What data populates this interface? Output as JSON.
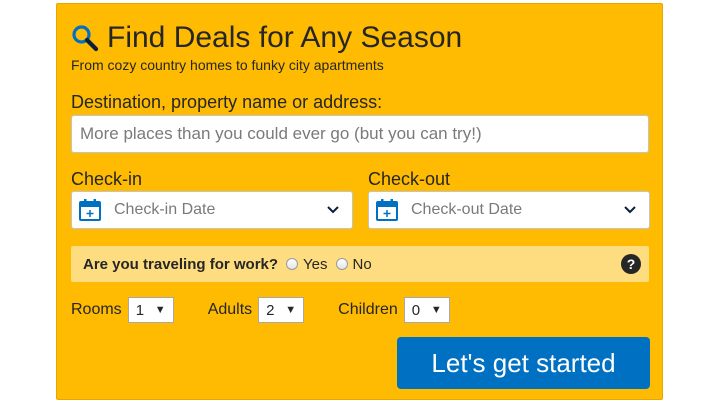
{
  "header": {
    "title": "Find Deals for Any Season",
    "subtitle": "From cozy country homes to funky city apartments",
    "icon": "search-icon"
  },
  "destination": {
    "label": "Destination, property name or address:",
    "placeholder": "More places than you could ever go (but you can try!)",
    "value": ""
  },
  "checkin": {
    "label": "Check-in",
    "placeholder": "Check-in Date",
    "icon": "calendar-icon"
  },
  "checkout": {
    "label": "Check-out",
    "placeholder": "Check-out Date",
    "icon": "calendar-icon"
  },
  "work": {
    "question": "Are you traveling for work?",
    "yes_label": "Yes",
    "no_label": "No",
    "help_icon": "help-icon",
    "help_glyph": "?"
  },
  "guests": {
    "rooms_label": "Rooms",
    "rooms_value": "1",
    "adults_label": "Adults",
    "adults_value": "2",
    "children_label": "Children",
    "children_value": "0"
  },
  "cta": {
    "label": "Let's get started"
  },
  "colors": {
    "panel": "#febb02",
    "work_bar": "#fedc80",
    "cta": "#0071c2",
    "calendar": "#0071c2"
  }
}
